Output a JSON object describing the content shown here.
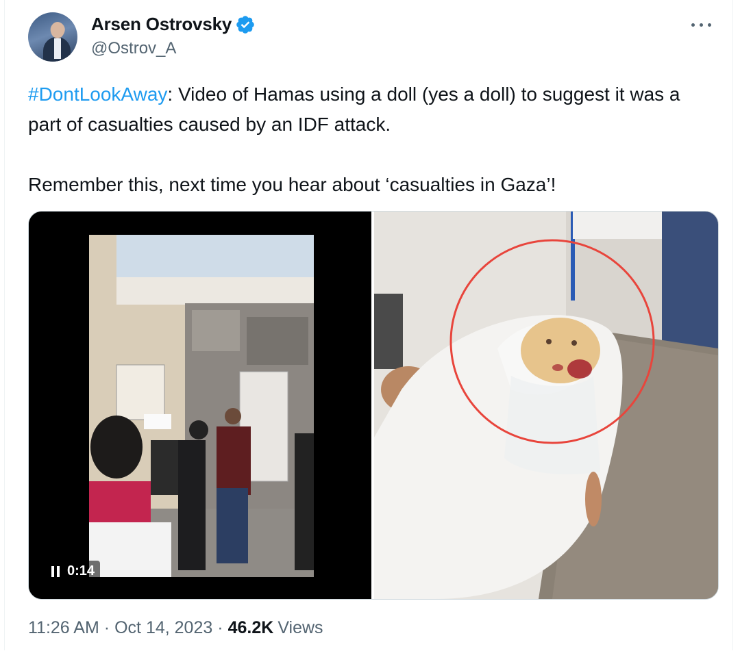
{
  "author": {
    "name": "Arsen Ostrovsky",
    "handle": "@Ostrov_A",
    "verified": true
  },
  "tweet": {
    "hashtag": "#DontLookAway",
    "text_after_hashtag": ": Video of Hamas using a doll (yes a doll) to suggest it was a part of casualties caused by an IDF attack.",
    "paragraph2": "Remember this, next time you hear about ‘casualties in Gaza’!"
  },
  "media": {
    "video_time": "0:14",
    "icons": [
      "pause-icon"
    ]
  },
  "meta": {
    "time": "11:26 AM",
    "date": "Oct 14, 2023",
    "views_count": "46.2K",
    "views_label": "Views",
    "separator": "·"
  },
  "colors": {
    "accent": "#1d9bf0",
    "text": "#0f1419",
    "secondary": "#536471",
    "circle": "#e8453c"
  }
}
